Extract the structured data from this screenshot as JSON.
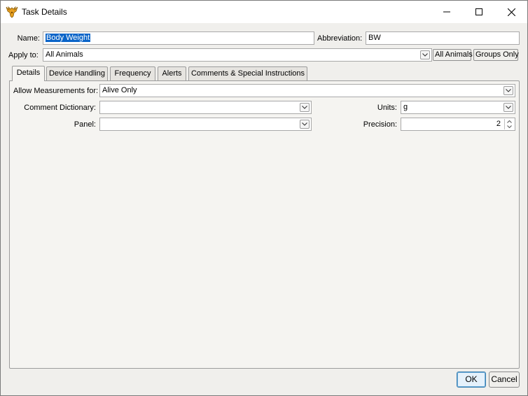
{
  "window": {
    "title": "Task Details",
    "icon": "animal-logo-icon",
    "controls": {
      "minimize": "minimize-icon",
      "maximize": "maximize-icon",
      "close": "close-icon"
    }
  },
  "form": {
    "name_label": "Name:",
    "name_value": "Body Weight",
    "abbreviation_label": "Abbreviation:",
    "abbreviation_value": "BW",
    "apply_to_label": "Apply to:",
    "apply_to_value": "All Animals",
    "all_animals_button": "All Animals",
    "groups_only_button": "Groups Only"
  },
  "tabs": [
    {
      "label": "Details",
      "active": true
    },
    {
      "label": "Device Handling",
      "active": false
    },
    {
      "label": "Frequency",
      "active": false
    },
    {
      "label": "Alerts",
      "active": false
    },
    {
      "label": "Comments & Special Instructions",
      "active": false
    }
  ],
  "details": {
    "allow_measurements_label": "Allow Measurements for:",
    "allow_measurements_value": "Alive Only",
    "comment_dictionary_label": "Comment Dictionary:",
    "comment_dictionary_value": "",
    "panel_label": "Panel:",
    "panel_value": "",
    "units_label": "Units:",
    "units_value": "g",
    "precision_label": "Precision:",
    "precision_value": "2"
  },
  "buttons": {
    "ok": "OK",
    "cancel": "Cancel"
  }
}
